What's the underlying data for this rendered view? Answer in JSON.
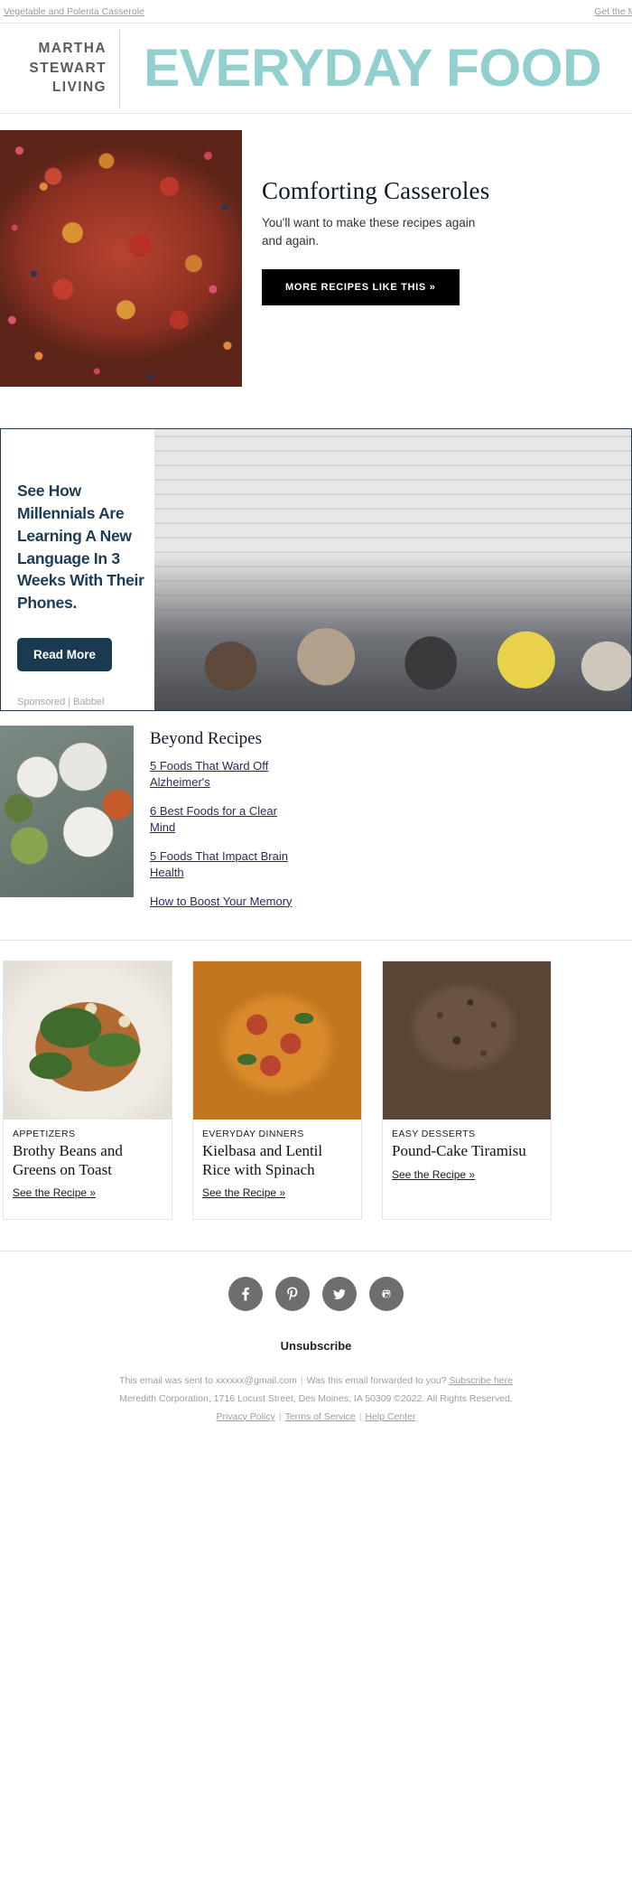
{
  "preheader": {
    "subject": "Vegetable and Polenta Casserole",
    "get_mag": "Get the Mag"
  },
  "masthead": {
    "brand_line1": "MARTHA",
    "brand_line2": "STEWART",
    "brand_line3": "LIVING",
    "publication": "EVERYDAY FOOD",
    "teal": "#92cfcf"
  },
  "hero": {
    "title": "Comforting Casseroles",
    "body": "You'll want to make these recipes again and again.",
    "cta": "MORE RECIPES LIKE THIS »",
    "image_alt": "vegetable-and-polenta-casserole-photo"
  },
  "ad": {
    "headline": "See How Millennials Are Learning A New Language In 3 Weeks With Their Phones.",
    "cta": "Read More",
    "sponsor_prefix": "Sponsored",
    "sponsor_sep": "|",
    "sponsor_brand": "Babbel",
    "sponsor_full": "Sponsored | Babbel",
    "image_alt": "friends-laughing-against-white-brick-wall",
    "border_color": "#1d3c55",
    "button_color": "#1a3a52"
  },
  "beyond": {
    "title": "Beyond Recipes",
    "image_alt": "bowls-of-healthy-foods-overhead",
    "links": [
      "5 Foods That Ward Off Alzheimer's",
      "6 Best Foods for a Clear Mind",
      "5 Foods That Impact Brain Health",
      "How to Boost Your Memory"
    ]
  },
  "cards": [
    {
      "category": "APPETIZERS",
      "title": "Brothy Beans and Greens on Toast",
      "link": "See the Recipe »",
      "image_alt": "brothy-beans-and-greens-on-toast-photo"
    },
    {
      "category": "EVERYDAY DINNERS",
      "title": "Kielbasa and Lentil Rice with Spinach",
      "link": "See the Recipe »",
      "image_alt": "kielbasa-and-lentil-rice-with-spinach-photo"
    },
    {
      "category": "EASY DESSERTS",
      "title": "Pound-Cake Tiramisu",
      "link": "See the Recipe »",
      "image_alt": "pound-cake-tiramisu-photo"
    }
  ],
  "footer": {
    "socials": [
      "facebook-icon",
      "pinterest-icon",
      "twitter-icon",
      "instagram-icon"
    ],
    "unsubscribe": "Unsubscribe",
    "sent_to": "This email was sent to xxxxxx@gmail.com",
    "forwarded": "Was this email forwarded to you?",
    "subscribe_here": "Subscribe here",
    "address": "Meredith Corporation, 1716 Locust Street, Des Moines, IA 50309 ©2022. All Rights Reserved.",
    "privacy": "Privacy Policy",
    "terms": "Terms of Service",
    "help": "Help Center",
    "divider": "|"
  }
}
